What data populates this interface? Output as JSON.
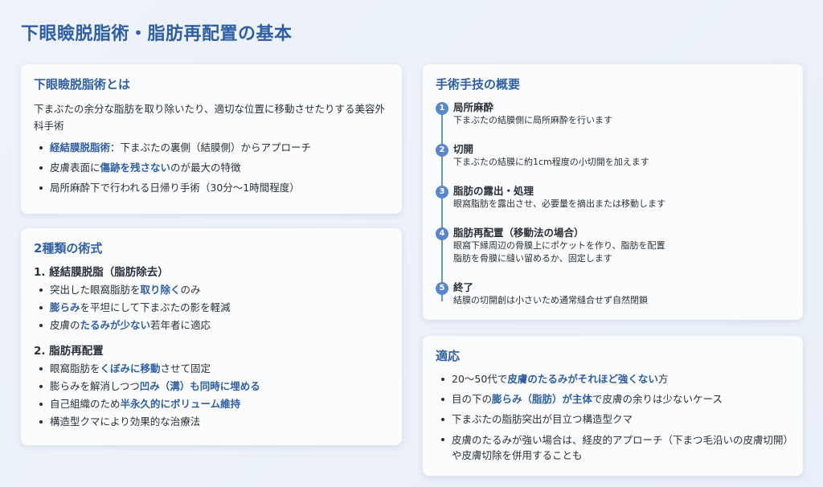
{
  "page_title": "下眼瞼脱脂術・脂肪再配置の基本",
  "about": {
    "heading": "下眼瞼脱脂術とは",
    "intro": "下まぶたの余分な脂肪を取り除いたり、適切な位置に移動させたりする美容外科手術",
    "b1_hl": "経結膜脱脂術",
    "b1_rest": "：下まぶたの裏側（結膜側）からアプローチ",
    "b2_pre": "皮膚表面に",
    "b2_hl": "傷跡を残さない",
    "b2_post": "のが最大の特徴",
    "b3": "局所麻酔下で行われる日帰り手術（30分〜1時間程度）"
  },
  "types": {
    "heading": "2種類の術式",
    "t1": {
      "title": "1. 経結膜脱脂（脂肪除去）",
      "i1_pre": "突出した眼窩脂肪を",
      "i1_hl": "取り除く",
      "i1_post": "のみ",
      "i2_hl": "膨らみ",
      "i2_post": "を平坦にして下まぶたの影を軽減",
      "i3_pre": "皮膚の",
      "i3_hl": "たるみが少ない",
      "i3_post": "若年者に適応"
    },
    "t2": {
      "title": "2. 脂肪再配置",
      "i1_pre": "眼窩脂肪を",
      "i1_hl": "くぼみに移動",
      "i1_post": "させて固定",
      "i2_pre": "膨らみを解消しつつ",
      "i2_hl": "凹み（溝）も同時に埋める",
      "i3_pre": "自己組織のため",
      "i3_hl": "半永久的にボリューム維持",
      "i4": "構造型クマにより効果的な治療法"
    }
  },
  "procedure": {
    "heading": "手術手技の概要",
    "steps": [
      {
        "num": "1",
        "title": "局所麻酔",
        "desc": "下まぶたの結膜側に局所麻酔を行います"
      },
      {
        "num": "2",
        "title": "切開",
        "desc": "下まぶたの結膜に約1cm程度の小切開を加えます"
      },
      {
        "num": "3",
        "title": "脂肪の露出・処理",
        "desc": "眼窩脂肪を露出させ、必要量を摘出または移動します"
      },
      {
        "num": "4",
        "title": "脂肪再配置（移動法の場合）",
        "desc": "眼窩下縁周辺の骨膜上にポケットを作り、脂肪を配置",
        "desc2": "脂肪を骨膜に縫い留めるか、固定します"
      },
      {
        "num": "5",
        "title": "終了",
        "desc": "結膜の切開創は小さいため通常縫合せず自然閉鎖"
      }
    ]
  },
  "indications": {
    "heading": "適応",
    "b1_pre": "20〜50代で",
    "b1_hl": "皮膚のたるみがそれほど強くない",
    "b1_post": "方",
    "b2_pre": "目の下の",
    "b2_hl": "膨らみ（脂肪）が主体",
    "b2_post": "で皮膚の余りは少ないケース",
    "b3": "下まぶたの脂肪突出が目立つ構造型クマ",
    "b4": "皮膚のたるみが強い場合は、経皮的アプローチ（下まつ毛沿いの皮膚切開）や皮膚切除を併用することも"
  }
}
